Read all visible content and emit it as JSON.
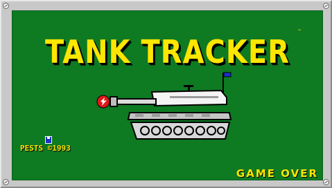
{
  "screen": {
    "title": "TANK TRACKER",
    "trademark": "™",
    "copyright": "PESTS ©1993",
    "credits": [
      "",
      "",
      ""
    ],
    "status": "GAME OVER"
  },
  "colors": {
    "background": "#0e7a22",
    "text": "#ffe600",
    "frame": "#c8c8c8",
    "muzzle_flash": "#e01818",
    "flag": "#1a2fd0"
  },
  "icons": [
    "tank-icon",
    "muzzle-flash-icon",
    "flag-icon",
    "floppy-disk-icon",
    "screw-icon"
  ]
}
